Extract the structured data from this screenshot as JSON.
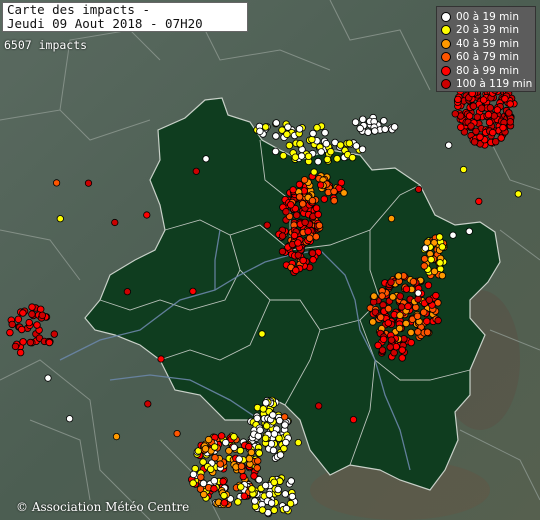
{
  "title": {
    "line1": "Carte des impacts -",
    "line2": "Jeudi 09 Aout 2018 - 07H20"
  },
  "impact_count": "6507 impacts",
  "legend": [
    {
      "label": "00 à 19 min",
      "color": "#ffffff"
    },
    {
      "label": "20 à 39 min",
      "color": "#ffff00"
    },
    {
      "label": "40 à 59 min",
      "color": "#ff9900"
    },
    {
      "label": "60 à 79 min",
      "color": "#ff5500"
    },
    {
      "label": "80 à 99 min",
      "color": "#ff0000"
    },
    {
      "label": "100 à 119 min",
      "color": "#cc0000"
    }
  ],
  "copyright": "© Association Météo Centre",
  "colors": {
    "terrain": "#4a5a4e",
    "region": "#0f3d1f",
    "borders": "#9aa39c",
    "rivers": "#6a86a8"
  }
}
